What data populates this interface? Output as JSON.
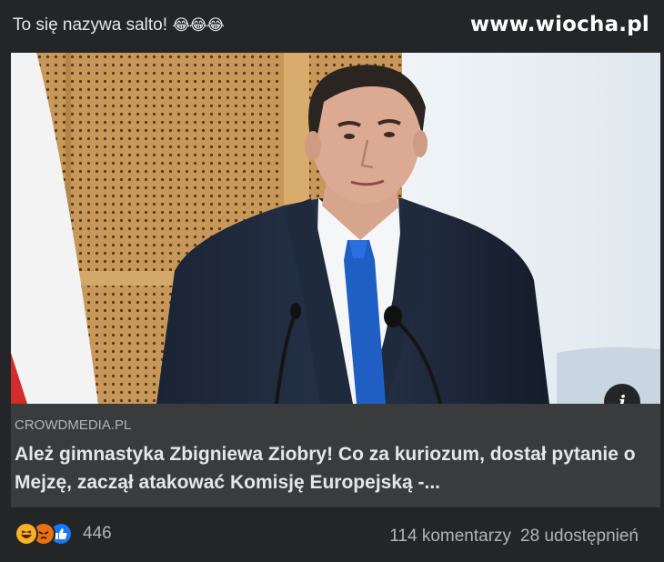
{
  "post": {
    "text": "To się nazywa salto!",
    "emojis": "😂😂😂"
  },
  "watermark": "www.wiocha.pl",
  "media": {
    "info_icon": "info-icon"
  },
  "link": {
    "source": "CROWDMEDIA.PL",
    "title": "Ależ gimnastyka Zbigniewa Ziobry! Co za kuriozum, dostał pytanie o Mejzę, zaczął atakować Komisję Europejską -..."
  },
  "footer": {
    "reaction_icons": [
      "haha-icon",
      "angry-icon",
      "like-icon"
    ],
    "reaction_count": "446",
    "comments": "114 komentarzy",
    "shares": "28 udostępnień"
  },
  "colors": {
    "background": "#242526",
    "card": "#3a3b3c",
    "like": "#1877f2",
    "haha": "#f7b125",
    "angry": "#e9710f"
  }
}
